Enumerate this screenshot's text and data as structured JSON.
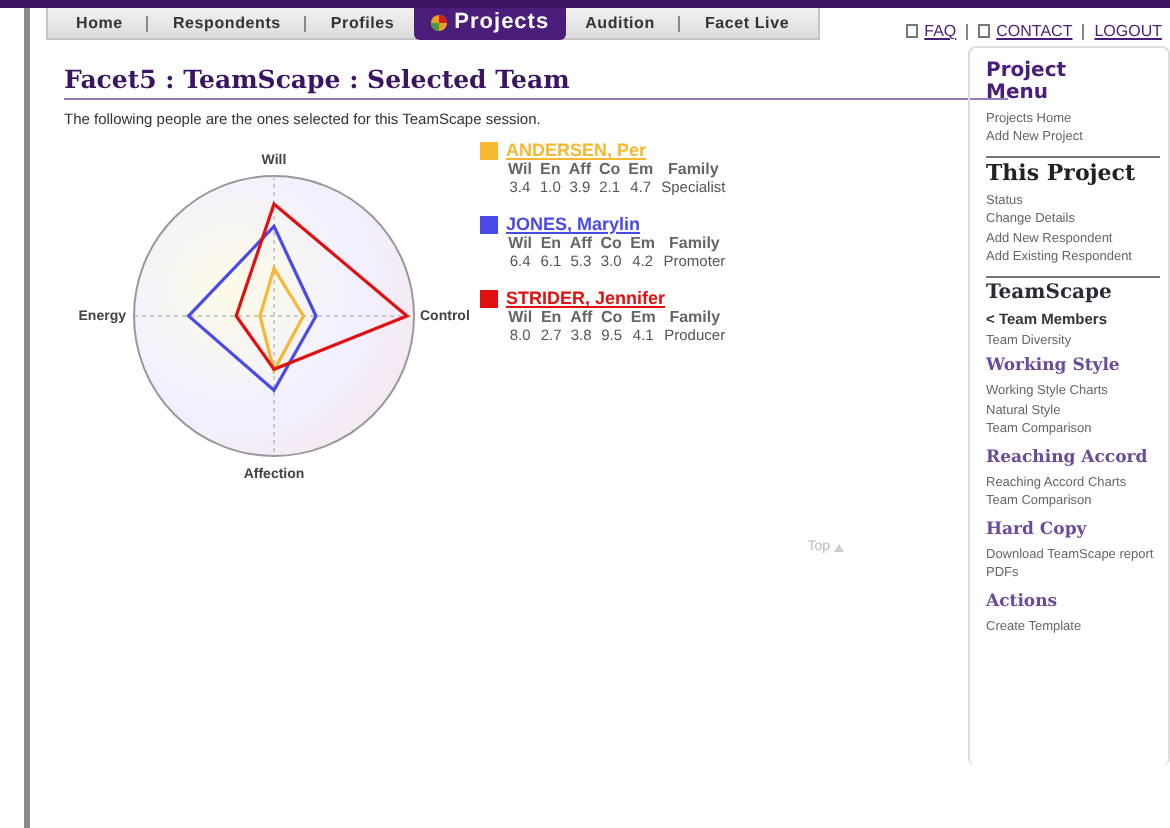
{
  "nav": {
    "tabs": [
      {
        "label": "Home",
        "selected": false
      },
      {
        "label": "Respondents",
        "selected": false
      },
      {
        "label": "Profiles",
        "selected": false
      },
      {
        "label": "Projects",
        "selected": true
      },
      {
        "label": "Audition",
        "selected": false
      },
      {
        "label": "Facet Live",
        "selected": false
      }
    ],
    "links": [
      "FAQ",
      "CONTACT",
      "LOGOUT"
    ]
  },
  "page": {
    "title": "Facet5 : TeamScape : Selected Team",
    "intro": "The following people are the ones selected for this TeamScape session.",
    "top_link": "Top"
  },
  "radar": {
    "axes": [
      "Will",
      "Energy",
      "Affection",
      "Control"
    ]
  },
  "people": [
    {
      "name": "ANDERSEN, Per",
      "color": "#f5b82e",
      "columns": [
        "Wil",
        "En",
        "Aff",
        "Co",
        "Em",
        "Family"
      ],
      "values": [
        "3.4",
        "1.0",
        "3.9",
        "2.1",
        "4.7",
        "Specialist"
      ]
    },
    {
      "name": "JONES, Marylin",
      "color": "#4a4ae8",
      "columns": [
        "Wil",
        "En",
        "Aff",
        "Co",
        "Em",
        "Family"
      ],
      "values": [
        "6.4",
        "6.1",
        "5.3",
        "3.0",
        "4.2",
        "Promoter"
      ]
    },
    {
      "name": "STRIDER, Jennifer",
      "color": "#e01010",
      "columns": [
        "Wil",
        "En",
        "Aff",
        "Co",
        "Em",
        "Family"
      ],
      "values": [
        "8.0",
        "2.7",
        "3.8",
        "9.5",
        "4.1",
        "Producer"
      ]
    }
  ],
  "sidebar": [
    {
      "kind": "head",
      "title": "Project Menu",
      "items": [
        {
          "label": "Projects Home",
          "selected": false
        },
        {
          "label": "Add New Project",
          "selected": false
        }
      ]
    },
    {
      "kind": "group",
      "title": "This Project",
      "items": [
        {
          "label": "Status",
          "selected": false
        },
        {
          "label": "Change Details",
          "selected": false
        },
        {
          "label": "Add New Respondent",
          "selected": false
        },
        {
          "label": "Add Existing Respondent",
          "selected": false
        }
      ]
    },
    {
      "kind": "section",
      "title": "TeamScape",
      "items": [
        {
          "label": "< Team Members",
          "selected": true
        },
        {
          "label": "Team Diversity",
          "selected": false
        }
      ]
    },
    {
      "kind": "sub",
      "title": "Working Style",
      "items": [
        {
          "label": "Working Style Charts",
          "selected": false
        },
        {
          "label": "Natural Style",
          "selected": false
        },
        {
          "label": "Team Comparison",
          "selected": false
        }
      ]
    },
    {
      "kind": "sub",
      "title": "Reaching Accord",
      "items": [
        {
          "label": "Reaching Accord Charts",
          "selected": false
        },
        {
          "label": "Team Comparison",
          "selected": false
        }
      ]
    },
    {
      "kind": "sub",
      "title": "Hard Copy",
      "items": [
        {
          "label": "Download TeamScape report PDFs",
          "selected": false
        }
      ]
    },
    {
      "kind": "sub",
      "title": "Actions",
      "items": [
        {
          "label": "Create Template",
          "selected": false
        }
      ]
    }
  ]
}
